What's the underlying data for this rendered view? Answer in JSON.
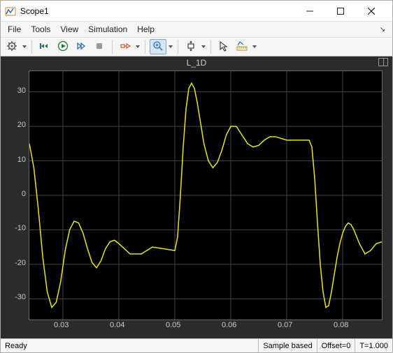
{
  "window": {
    "title": "Scope1"
  },
  "menu": {
    "items": [
      "File",
      "Tools",
      "View",
      "Simulation",
      "Help"
    ]
  },
  "toolbar": {
    "icons": [
      "gear",
      "restart",
      "run",
      "step-forward",
      "stop",
      "highlight",
      "zoom-in",
      "autoscale",
      "cursor",
      "measure"
    ]
  },
  "status": {
    "ready": "Ready",
    "mode": "Sample based",
    "offset": "Offset=0",
    "time": "T=1.000"
  },
  "chart_data": {
    "type": "line",
    "title": "L_1D",
    "xlabel": "",
    "ylabel": "",
    "xlim": [
      0.024,
      0.087
    ],
    "ylim": [
      -36,
      36
    ],
    "xticks": [
      0.03,
      0.04,
      0.05,
      0.06,
      0.07,
      0.08
    ],
    "yticks": [
      -30,
      -20,
      -10,
      0,
      10,
      20,
      30
    ],
    "series": [
      {
        "name": "L_1D",
        "color": "#e6e619",
        "x": [
          0.024,
          0.0248,
          0.0256,
          0.0264,
          0.0272,
          0.028,
          0.0288,
          0.0296,
          0.0304,
          0.0312,
          0.032,
          0.0328,
          0.0336,
          0.0344,
          0.0352,
          0.036,
          0.0368,
          0.0376,
          0.0384,
          0.0392,
          0.04,
          0.042,
          0.044,
          0.046,
          0.048,
          0.05,
          0.0505,
          0.051,
          0.0515,
          0.052,
          0.0525,
          0.053,
          0.0535,
          0.054,
          0.0545,
          0.0552,
          0.056,
          0.0568,
          0.0576,
          0.0584,
          0.0592,
          0.06,
          0.061,
          0.062,
          0.063,
          0.064,
          0.065,
          0.066,
          0.067,
          0.068,
          0.069,
          0.07,
          0.071,
          0.072,
          0.073,
          0.074,
          0.0745,
          0.075,
          0.0755,
          0.076,
          0.0765,
          0.077,
          0.0775,
          0.078,
          0.0785,
          0.079,
          0.0795,
          0.08,
          0.0805,
          0.081,
          0.0815,
          0.082,
          0.083,
          0.084,
          0.085,
          0.086,
          0.087
        ],
        "y": [
          15.0,
          8.0,
          -4.0,
          -18.0,
          -28.0,
          -32.5,
          -31.0,
          -25.0,
          -16.0,
          -10.0,
          -7.5,
          -8.0,
          -11.0,
          -15.5,
          -19.5,
          -21.0,
          -19.0,
          -15.5,
          -13.5,
          -13.0,
          -14.0,
          -17.0,
          -17.0,
          -15.0,
          -15.5,
          -16.0,
          -12.0,
          0.0,
          14.0,
          25.0,
          31.0,
          32.5,
          31.0,
          27.0,
          22.0,
          15.0,
          10.0,
          8.0,
          9.5,
          13.0,
          17.5,
          20.0,
          20.0,
          17.5,
          15.0,
          14.0,
          14.5,
          16.0,
          17.0,
          17.0,
          16.5,
          16.0,
          16.0,
          16.0,
          16.0,
          16.0,
          14.0,
          5.0,
          -8.0,
          -20.0,
          -28.0,
          -32.5,
          -32.0,
          -28.0,
          -23.0,
          -18.0,
          -14.0,
          -11.0,
          -9.0,
          -8.0,
          -8.5,
          -10.0,
          -14.0,
          -17.0,
          -16.0,
          -14.0,
          -13.5
        ]
      }
    ]
  }
}
